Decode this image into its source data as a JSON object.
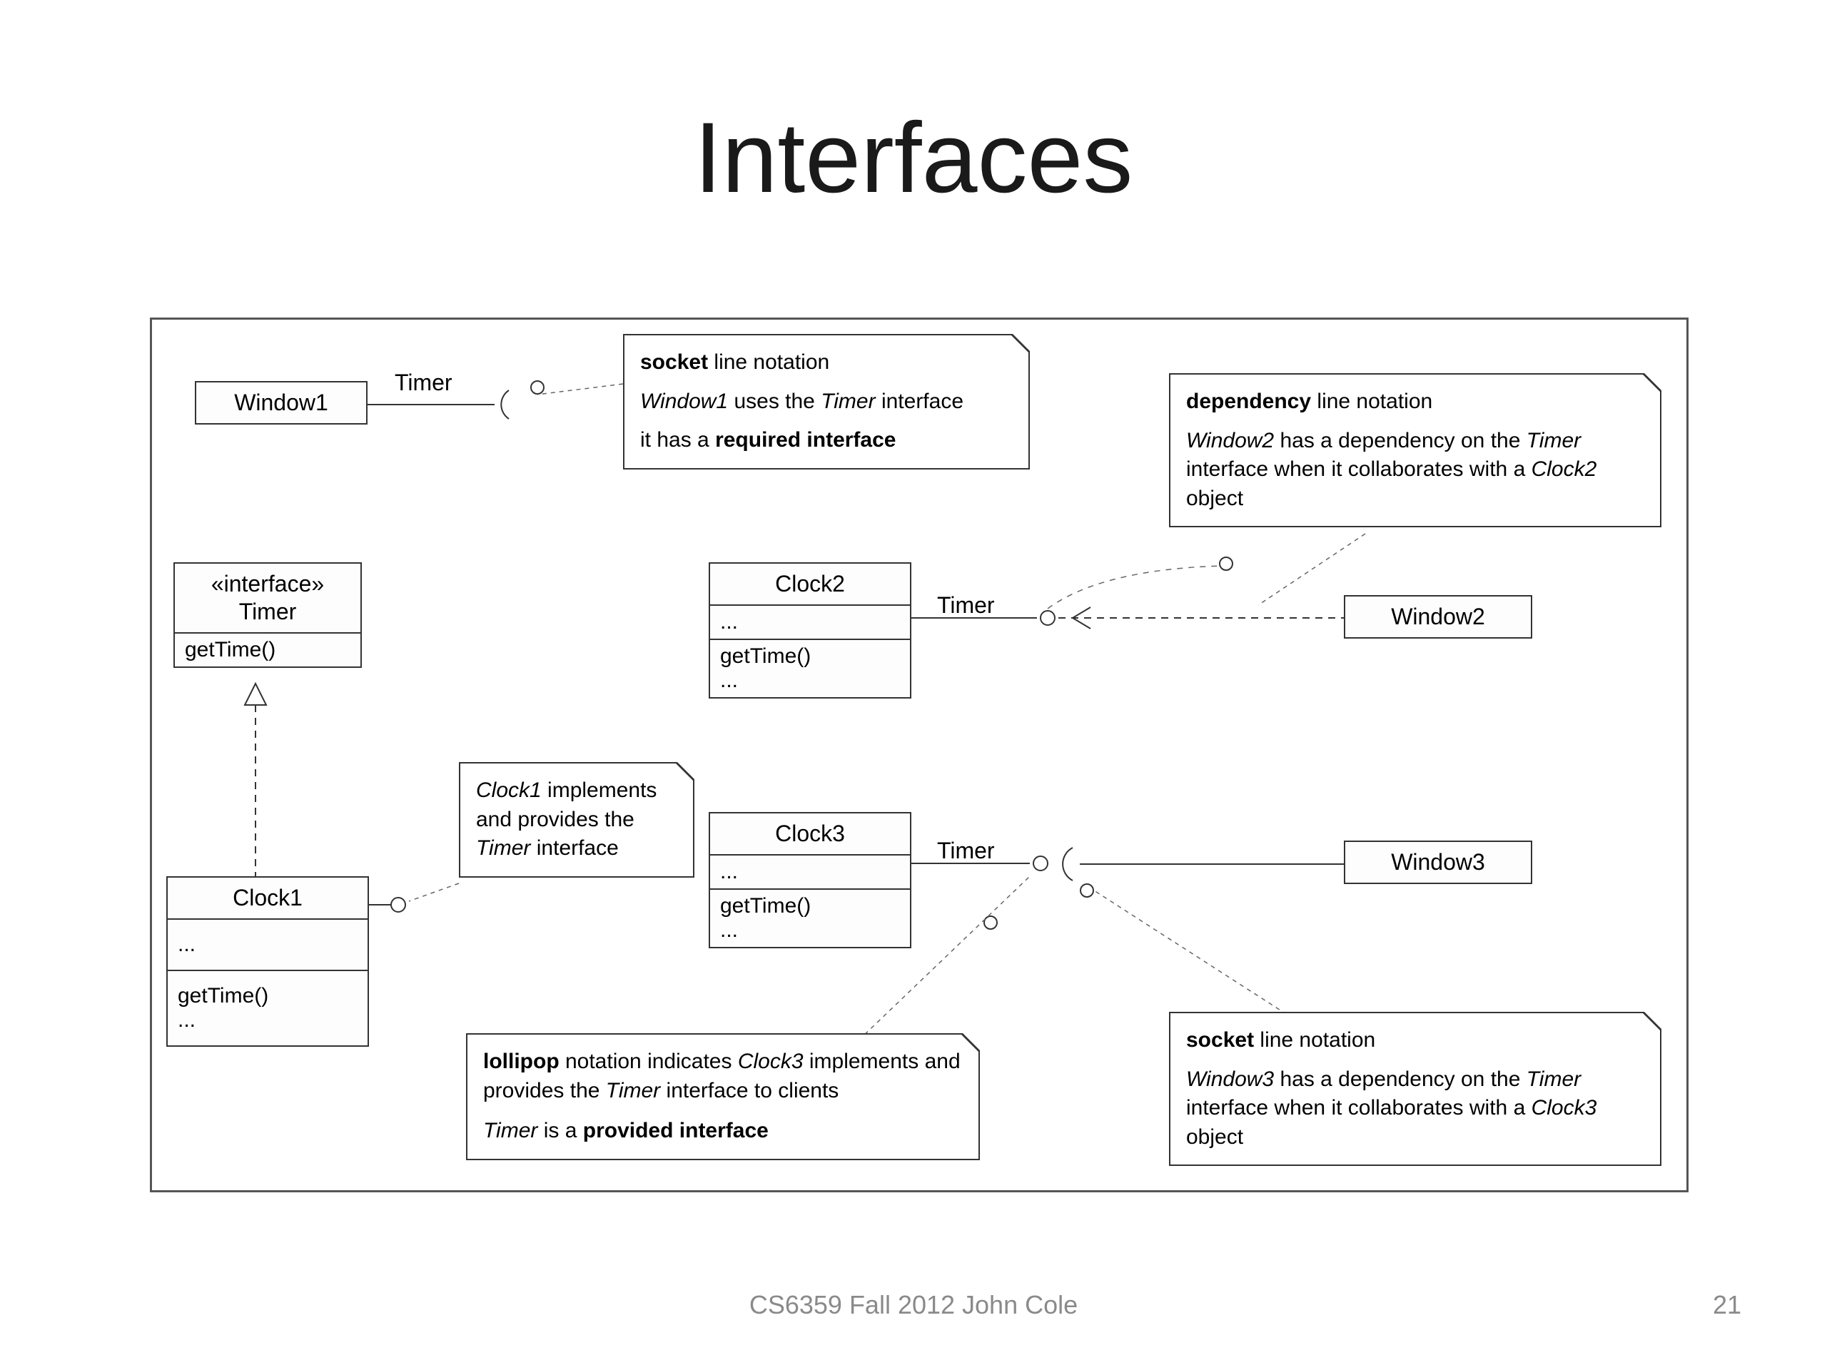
{
  "title": "Interfaces",
  "footer": {
    "center": "CS6359 Fall 2012 John Cole",
    "page": "21"
  },
  "labels": {
    "timer1": "Timer",
    "timer2": "Timer",
    "timer3": "Timer"
  },
  "boxes": {
    "window1": "Window1",
    "window2": "Window2",
    "window3": "Window3",
    "interfaceStereo": "«interface»",
    "interfaceName": "Timer",
    "interfaceOp": "getTime()",
    "clock1": {
      "name": "Clock1",
      "row1": "...",
      "row2a": "getTime()",
      "row2b": "..."
    },
    "clock2": {
      "name": "Clock2",
      "row1": "...",
      "row2a": "getTime()",
      "row2b": "..."
    },
    "clock3": {
      "name": "Clock3",
      "row1": "...",
      "row2a": "getTime()",
      "row2b": "..."
    }
  },
  "notes": {
    "socketTop": {
      "l1a": "socket",
      "l1b": " line notation",
      "l2a": "Window1",
      "l2b": " uses the ",
      "l2c": "Timer",
      "l2d": " interface",
      "l3a": "it has a ",
      "l3b": "required interface"
    },
    "depTop": {
      "l1a": "dependency",
      "l1b": " line notation",
      "l2a": "Window2",
      "l2b": " has a dependency on the ",
      "l2c": "Timer",
      "l2d": " interface when it collaborates with a ",
      "l2e": "Clock2",
      "l2f": " object"
    },
    "clock1Note": {
      "l1a": "Clock1",
      "l1b": " implements and provides the ",
      "l1c": "Timer",
      "l1d": " interface"
    },
    "lollipop": {
      "l1a": "lollipop",
      "l1b": " notation indicates ",
      "l1c": "Clock3",
      "l1d": " implements and provides the ",
      "l1e": "Timer",
      "l1f": " interface to clients",
      "l2a": "Timer",
      "l2b": " is a ",
      "l2c": "provided interface"
    },
    "socketBottom": {
      "l1a": "socket",
      "l1b": " line notation",
      "l2a": "Window3",
      "l2b": " has a dependency on the ",
      "l2c": "Timer",
      "l2d": " interface when it collaborates with a ",
      "l2e": "Clock3",
      "l2f": " object"
    }
  }
}
